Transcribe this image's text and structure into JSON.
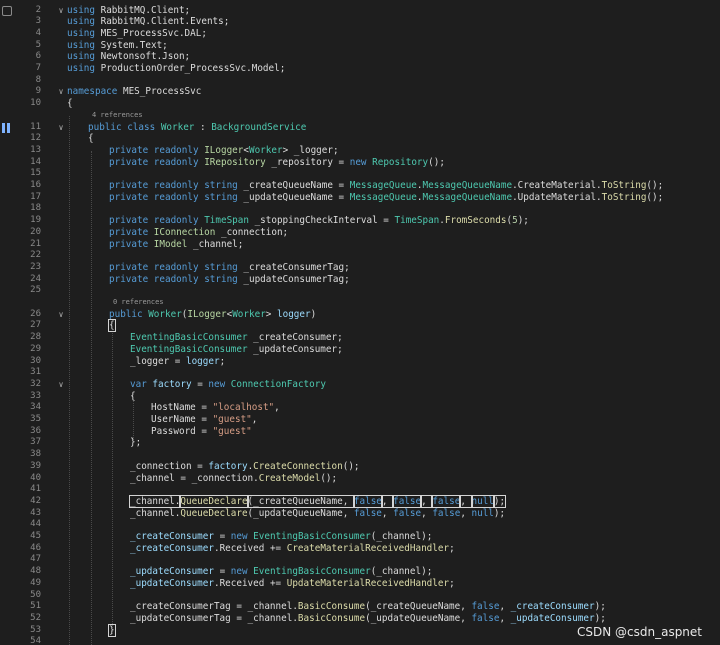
{
  "editor": {
    "lines": [
      {
        "kind": "code",
        "num": "2",
        "indent": 0,
        "fold": "v",
        "tokens": [
          [
            "kw",
            "using"
          ],
          [
            "",
            " RabbitMQ.Client;"
          ]
        ]
      },
      {
        "kind": "code",
        "num": "3",
        "indent": 0,
        "tokens": [
          [
            "kw",
            "using"
          ],
          [
            "",
            " RabbitMQ.Client.Events;"
          ]
        ]
      },
      {
        "kind": "code",
        "num": "4",
        "indent": 0,
        "tokens": [
          [
            "kw",
            "using"
          ],
          [
            "",
            " MES_ProcessSvc.DAL;"
          ]
        ]
      },
      {
        "kind": "code",
        "num": "5",
        "indent": 0,
        "tokens": [
          [
            "kw",
            "using"
          ],
          [
            "",
            " System.Text;"
          ]
        ]
      },
      {
        "kind": "code",
        "num": "6",
        "indent": 0,
        "tokens": [
          [
            "kw",
            "using"
          ],
          [
            "",
            " Newtonsoft.Json;"
          ]
        ]
      },
      {
        "kind": "code",
        "num": "7",
        "indent": 0,
        "tokens": [
          [
            "kw",
            "using"
          ],
          [
            "",
            " ProductionOrder_ProcessSvc.Model;"
          ]
        ]
      },
      {
        "kind": "code",
        "num": "8",
        "indent": 0,
        "tokens": []
      },
      {
        "kind": "code",
        "num": "9",
        "indent": 0,
        "fold": "v",
        "tokens": [
          [
            "kw",
            "namespace"
          ],
          [
            "",
            " MES_ProcessSvc"
          ]
        ]
      },
      {
        "kind": "code",
        "num": "10",
        "indent": 0,
        "tokens": [
          [
            "",
            "{"
          ]
        ]
      },
      {
        "kind": "ref",
        "indent": 5,
        "text": "4 references"
      },
      {
        "kind": "code",
        "num": "11",
        "indent": 5,
        "fold": "v",
        "tokens": [
          [
            "kw",
            "public"
          ],
          [
            "",
            " "
          ],
          [
            "kw",
            "class"
          ],
          [
            "",
            " "
          ],
          [
            "ty",
            "Worker"
          ],
          [
            "",
            " : "
          ],
          [
            "ty",
            "BackgroundService"
          ]
        ]
      },
      {
        "kind": "code",
        "num": "12",
        "indent": 5,
        "tokens": [
          [
            "",
            "{"
          ]
        ]
      },
      {
        "kind": "code",
        "num": "13",
        "indent": 10,
        "tokens": [
          [
            "kw",
            "private"
          ],
          [
            "",
            " "
          ],
          [
            "kw",
            "readonly"
          ],
          [
            "",
            " "
          ],
          [
            "it",
            "ILogger"
          ],
          [
            "",
            "<"
          ],
          [
            "ty",
            "Worker"
          ],
          [
            "",
            "> _logger;"
          ]
        ]
      },
      {
        "kind": "code",
        "num": "14",
        "indent": 10,
        "tokens": [
          [
            "kw",
            "private"
          ],
          [
            "",
            " "
          ],
          [
            "kw",
            "readonly"
          ],
          [
            "",
            " "
          ],
          [
            "it",
            "IRepository"
          ],
          [
            "",
            " _repository = "
          ],
          [
            "kw",
            "new"
          ],
          [
            "",
            " "
          ],
          [
            "ty",
            "Repository"
          ],
          [
            "",
            "();"
          ]
        ]
      },
      {
        "kind": "code",
        "num": "15",
        "indent": 0,
        "tokens": []
      },
      {
        "kind": "code",
        "num": "16",
        "indent": 10,
        "tokens": [
          [
            "kw",
            "private"
          ],
          [
            "",
            " "
          ],
          [
            "kw",
            "readonly"
          ],
          [
            "",
            " "
          ],
          [
            "kw",
            "string"
          ],
          [
            "",
            " _createQueueName = "
          ],
          [
            "ty",
            "MessageQueue"
          ],
          [
            "",
            "."
          ],
          [
            "ty",
            "MessageQueueName"
          ],
          [
            "",
            ".CreateMaterial."
          ],
          [
            "mt",
            "ToString"
          ],
          [
            "",
            "();"
          ]
        ]
      },
      {
        "kind": "code",
        "num": "17",
        "indent": 10,
        "tokens": [
          [
            "kw",
            "private"
          ],
          [
            "",
            " "
          ],
          [
            "kw",
            "readonly"
          ],
          [
            "",
            " "
          ],
          [
            "kw",
            "string"
          ],
          [
            "",
            " _updateQueueName = "
          ],
          [
            "ty",
            "MessageQueue"
          ],
          [
            "",
            "."
          ],
          [
            "ty",
            "MessageQueueName"
          ],
          [
            "",
            ".UpdateMaterial."
          ],
          [
            "mt",
            "ToString"
          ],
          [
            "",
            "();"
          ]
        ]
      },
      {
        "kind": "code",
        "num": "18",
        "indent": 0,
        "tokens": []
      },
      {
        "kind": "code",
        "num": "19",
        "indent": 10,
        "tokens": [
          [
            "kw",
            "private"
          ],
          [
            "",
            " "
          ],
          [
            "kw",
            "readonly"
          ],
          [
            "",
            " "
          ],
          [
            "ty",
            "TimeSpan"
          ],
          [
            "",
            " _stoppingCheckInterval = "
          ],
          [
            "ty",
            "TimeSpan"
          ],
          [
            "",
            "."
          ],
          [
            "mt",
            "FromSeconds"
          ],
          [
            "",
            "("
          ],
          [
            "nm",
            "5"
          ],
          [
            "",
            ");"
          ]
        ]
      },
      {
        "kind": "code",
        "num": "20",
        "indent": 10,
        "tokens": [
          [
            "kw",
            "private"
          ],
          [
            "",
            " "
          ],
          [
            "it",
            "IConnection"
          ],
          [
            "",
            " _connection;"
          ]
        ]
      },
      {
        "kind": "code",
        "num": "21",
        "indent": 10,
        "tokens": [
          [
            "kw",
            "private"
          ],
          [
            "",
            " "
          ],
          [
            "it",
            "IModel"
          ],
          [
            "",
            " _channel;"
          ]
        ]
      },
      {
        "kind": "code",
        "num": "22",
        "indent": 0,
        "tokens": []
      },
      {
        "kind": "code",
        "num": "23",
        "indent": 10,
        "tokens": [
          [
            "kw",
            "private"
          ],
          [
            "",
            " "
          ],
          [
            "kw",
            "readonly"
          ],
          [
            "",
            " "
          ],
          [
            "kw",
            "string"
          ],
          [
            "",
            " _createConsumerTag;"
          ]
        ]
      },
      {
        "kind": "code",
        "num": "24",
        "indent": 10,
        "tokens": [
          [
            "kw",
            "private"
          ],
          [
            "",
            " "
          ],
          [
            "kw",
            "readonly"
          ],
          [
            "",
            " "
          ],
          [
            "kw",
            "string"
          ],
          [
            "",
            " _updateConsumerTag;"
          ]
        ]
      },
      {
        "kind": "code",
        "num": "25",
        "indent": 0,
        "tokens": []
      },
      {
        "kind": "ref",
        "indent": 10,
        "text": "0 references"
      },
      {
        "kind": "code",
        "num": "26",
        "indent": 10,
        "fold": "v",
        "tokens": [
          [
            "kw",
            "public"
          ],
          [
            "",
            " "
          ],
          [
            "ty",
            "Worker"
          ],
          [
            "",
            "("
          ],
          [
            "it",
            "ILogger"
          ],
          [
            "",
            "<"
          ],
          [
            "ty",
            "Worker"
          ],
          [
            "",
            "> "
          ],
          [
            "vr",
            "logger"
          ],
          [
            "",
            ")"
          ]
        ]
      },
      {
        "kind": "code",
        "num": "27",
        "indent": 10,
        "tokens": [
          [
            "hl",
            "{"
          ]
        ]
      },
      {
        "kind": "code",
        "num": "28",
        "indent": 15,
        "tokens": [
          [
            "ty",
            "EventingBasicConsumer"
          ],
          [
            "",
            " _createConsumer;"
          ]
        ]
      },
      {
        "kind": "code",
        "num": "29",
        "indent": 15,
        "tokens": [
          [
            "ty",
            "EventingBasicConsumer"
          ],
          [
            "",
            " _updateConsumer;"
          ]
        ]
      },
      {
        "kind": "code",
        "num": "30",
        "indent": 15,
        "tokens": [
          [
            "",
            "_logger = "
          ],
          [
            "vr",
            "logger"
          ],
          [
            "",
            ";"
          ]
        ]
      },
      {
        "kind": "code",
        "num": "31",
        "indent": 0,
        "tokens": []
      },
      {
        "kind": "code",
        "num": "32",
        "indent": 15,
        "fold": "v",
        "tokens": [
          [
            "kw",
            "var"
          ],
          [
            "",
            " "
          ],
          [
            "vr",
            "factory"
          ],
          [
            "",
            " = "
          ],
          [
            "kw",
            "new"
          ],
          [
            "",
            " "
          ],
          [
            "ty",
            "ConnectionFactory"
          ]
        ]
      },
      {
        "kind": "code",
        "num": "33",
        "indent": 15,
        "tokens": [
          [
            "",
            "{"
          ]
        ]
      },
      {
        "kind": "code",
        "num": "34",
        "indent": 20,
        "tokens": [
          [
            "",
            "HostName = "
          ],
          [
            "st",
            "\"localhost\""
          ],
          [
            "",
            ","
          ]
        ]
      },
      {
        "kind": "code",
        "num": "35",
        "indent": 20,
        "tokens": [
          [
            "",
            "UserName = "
          ],
          [
            "st",
            "\"guest\""
          ],
          [
            "",
            ","
          ]
        ]
      },
      {
        "kind": "code",
        "num": "36",
        "indent": 20,
        "tokens": [
          [
            "",
            "Password = "
          ],
          [
            "st",
            "\"guest\""
          ]
        ]
      },
      {
        "kind": "code",
        "num": "37",
        "indent": 15,
        "tokens": [
          [
            "",
            "};"
          ]
        ]
      },
      {
        "kind": "code",
        "num": "38",
        "indent": 0,
        "tokens": []
      },
      {
        "kind": "code",
        "num": "39",
        "indent": 15,
        "tokens": [
          [
            "",
            "_connection = "
          ],
          [
            "vr",
            "factory"
          ],
          [
            "",
            "."
          ],
          [
            "mt",
            "CreateConnection"
          ],
          [
            "",
            "();"
          ]
        ]
      },
      {
        "kind": "code",
        "num": "40",
        "indent": 15,
        "tokens": [
          [
            "",
            "_channel = _connection."
          ],
          [
            "mt",
            "CreateModel"
          ],
          [
            "",
            "();"
          ]
        ]
      },
      {
        "kind": "code",
        "num": "41",
        "indent": 0,
        "tokens": []
      },
      {
        "kind": "code",
        "num": "42",
        "indent": 15,
        "tokens": [
          [
            "hl",
            "_channel."
          ],
          [
            "hlmt",
            "QueueDeclare"
          ],
          [
            "hl",
            "(_createQueueName, "
          ],
          [
            "hlkw",
            "false"
          ],
          [
            "hl",
            ", "
          ],
          [
            "hlkw",
            "false"
          ],
          [
            "hl",
            ", "
          ],
          [
            "hlkw",
            "false"
          ],
          [
            "hl",
            ", "
          ],
          [
            "hlkw",
            "null"
          ],
          [
            "hl",
            ");"
          ]
        ]
      },
      {
        "kind": "code",
        "num": "43",
        "indent": 15,
        "tokens": [
          [
            "",
            "_channel."
          ],
          [
            "mt",
            "QueueDeclare"
          ],
          [
            "",
            "(_updateQueueName, "
          ],
          [
            "kw",
            "false"
          ],
          [
            "",
            ", "
          ],
          [
            "kw",
            "false"
          ],
          [
            "",
            ", "
          ],
          [
            "kw",
            "false"
          ],
          [
            "",
            ", "
          ],
          [
            "kw",
            "null"
          ],
          [
            "",
            ");"
          ]
        ]
      },
      {
        "kind": "code",
        "num": "44",
        "indent": 0,
        "tokens": []
      },
      {
        "kind": "code",
        "num": "45",
        "indent": 15,
        "tokens": [
          [
            "vr",
            "_createConsumer"
          ],
          [
            "",
            " = "
          ],
          [
            "kw",
            "new"
          ],
          [
            "",
            " "
          ],
          [
            "ty",
            "EventingBasicConsumer"
          ],
          [
            "",
            "(_channel);"
          ]
        ]
      },
      {
        "kind": "code",
        "num": "46",
        "indent": 15,
        "tokens": [
          [
            "vr",
            "_createConsumer"
          ],
          [
            "",
            ".Received += "
          ],
          [
            "mt",
            "CreateMaterialReceivedHandler"
          ],
          [
            "",
            ";"
          ]
        ]
      },
      {
        "kind": "code",
        "num": "47",
        "indent": 0,
        "tokens": []
      },
      {
        "kind": "code",
        "num": "48",
        "indent": 15,
        "tokens": [
          [
            "vr",
            "_updateConsumer"
          ],
          [
            "",
            " = "
          ],
          [
            "kw",
            "new"
          ],
          [
            "",
            " "
          ],
          [
            "ty",
            "EventingBasicConsumer"
          ],
          [
            "",
            "(_channel);"
          ]
        ]
      },
      {
        "kind": "code",
        "num": "49",
        "indent": 15,
        "tokens": [
          [
            "vr",
            "_updateConsumer"
          ],
          [
            "",
            ".Received += "
          ],
          [
            "mt",
            "UpdateMaterialReceivedHandler"
          ],
          [
            "",
            ";"
          ]
        ]
      },
      {
        "kind": "code",
        "num": "50",
        "indent": 0,
        "tokens": []
      },
      {
        "kind": "code",
        "num": "51",
        "indent": 15,
        "tokens": [
          [
            "",
            "_createConsumerTag = _channel."
          ],
          [
            "mt",
            "BasicConsume"
          ],
          [
            "",
            "(_createQueueName, "
          ],
          [
            "kw",
            "false"
          ],
          [
            "",
            ", "
          ],
          [
            "vr",
            "_createConsumer"
          ],
          [
            "",
            ");"
          ]
        ]
      },
      {
        "kind": "code",
        "num": "52",
        "indent": 15,
        "tokens": [
          [
            "",
            "_updateConsumerTag = _channel."
          ],
          [
            "mt",
            "BasicConsume"
          ],
          [
            "",
            "(_updateQueueName, "
          ],
          [
            "kw",
            "false"
          ],
          [
            "",
            ", "
          ],
          [
            "vr",
            "_updateConsumer"
          ],
          [
            "",
            ");"
          ]
        ]
      },
      {
        "kind": "code",
        "num": "53",
        "indent": 10,
        "tokens": [
          [
            "hl",
            "}"
          ]
        ]
      },
      {
        "kind": "code",
        "num": "54",
        "indent": 0,
        "tokens": []
      }
    ]
  },
  "watermark": "CSDN @csdn_aspnet",
  "colors": {
    "background": "#1e1e1e",
    "keyword": "#569cd6",
    "type": "#4ec9b0",
    "interface": "#b8d7a3",
    "string": "#d69d85",
    "method": "#dcdcaa",
    "number": "#b5cea8",
    "variable": "#9cdcfe",
    "line_number": "#8a8a8a"
  },
  "icons": [
    "fold-chevron-icon",
    "breakpoint-glyph-icon",
    "class-glyph-icon"
  ]
}
